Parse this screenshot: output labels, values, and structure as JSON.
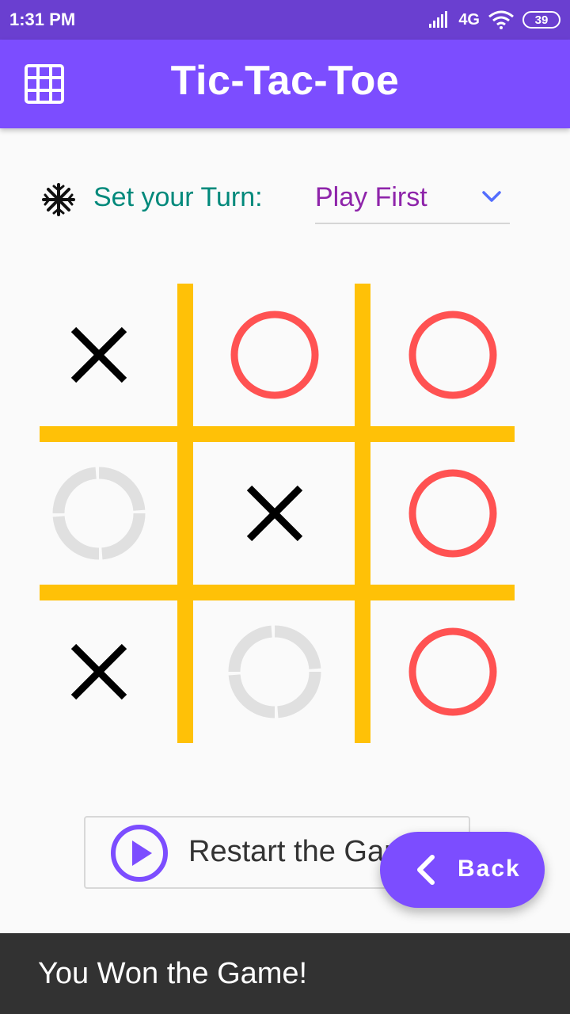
{
  "status_bar": {
    "time": "1:31 PM",
    "network": "4G",
    "battery": "39"
  },
  "app_bar": {
    "title": "Tic-Tac-Toe",
    "icon": "grid-menu-icon"
  },
  "turn": {
    "label": "Set your Turn:",
    "selected": "Play First",
    "icon": "snowflake-icon"
  },
  "board": {
    "cells": [
      {
        "row": 1,
        "col": 1,
        "mark": "X"
      },
      {
        "row": 1,
        "col": 2,
        "mark": "O"
      },
      {
        "row": 1,
        "col": 3,
        "mark": "O"
      },
      {
        "row": 2,
        "col": 1,
        "mark": "empty"
      },
      {
        "row": 2,
        "col": 2,
        "mark": "X"
      },
      {
        "row": 2,
        "col": 3,
        "mark": "O"
      },
      {
        "row": 3,
        "col": 1,
        "mark": "X"
      },
      {
        "row": 3,
        "col": 2,
        "mark": "empty"
      },
      {
        "row": 3,
        "col": 3,
        "mark": "O"
      }
    ],
    "colors": {
      "lines": "#ffc107",
      "x": "#000000",
      "o": "#ff5252",
      "empty": "#e0e0e0"
    }
  },
  "restart": {
    "label": "Restart the Game"
  },
  "back": {
    "label": "Back"
  },
  "snackbar": {
    "message": "You Won the Game!"
  },
  "colors": {
    "primary": "#7c4dff",
    "status_bar": "#6a3fd0",
    "turn_label": "#00897b",
    "turn_value": "#8e24aa"
  }
}
